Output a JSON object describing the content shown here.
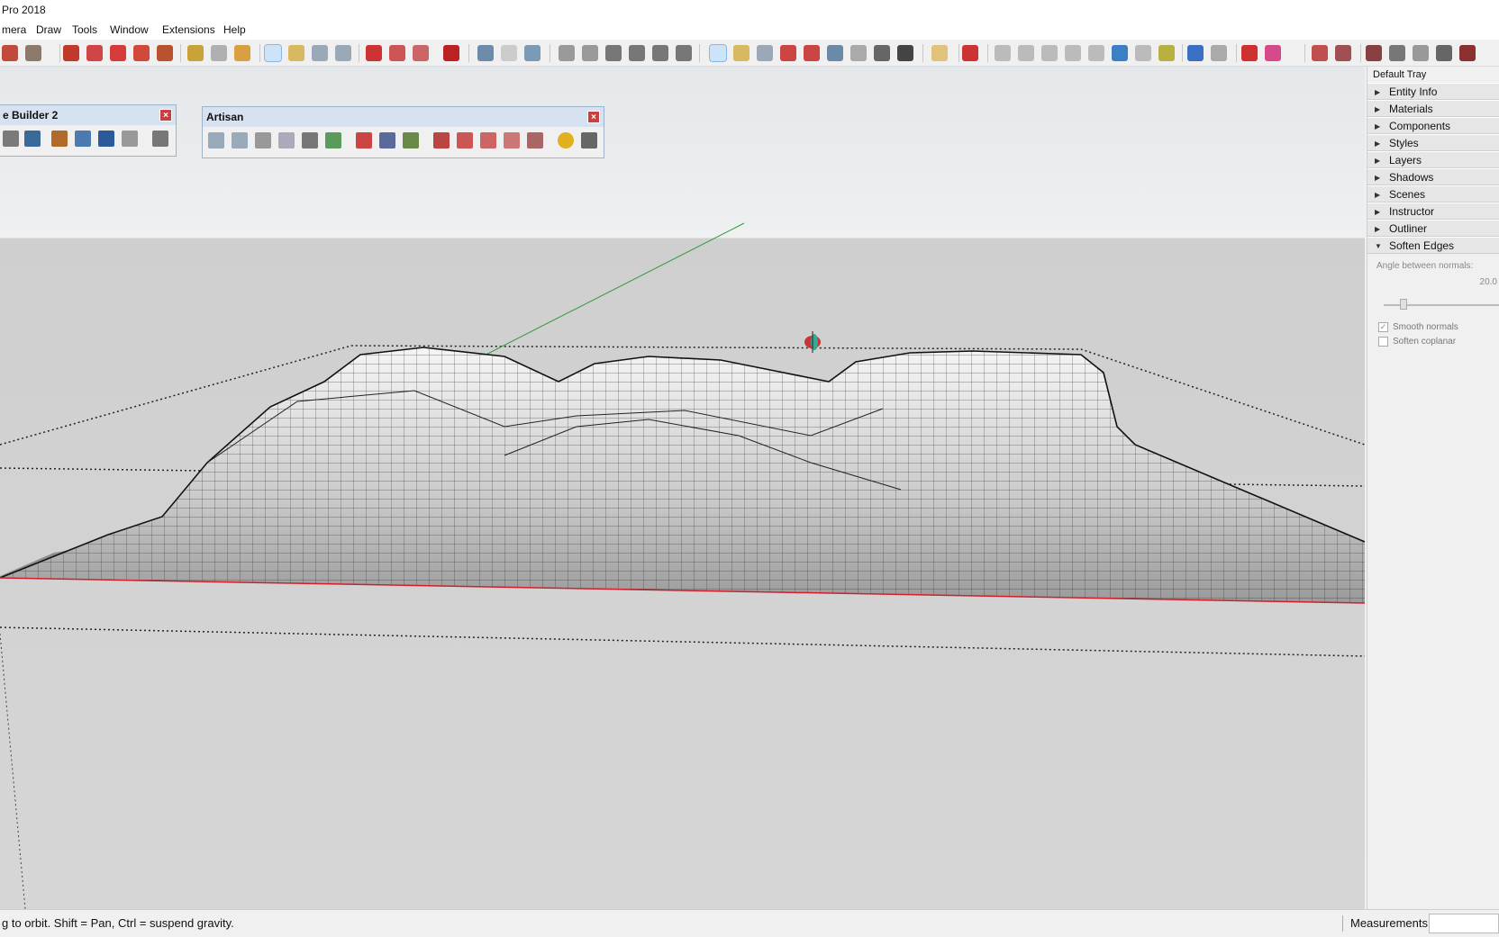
{
  "window": {
    "title": "Pro 2018"
  },
  "menu": [
    "mera",
    "Draw",
    "Tools",
    "Window",
    "Extensions",
    "Help"
  ],
  "toolbars": {
    "builder": {
      "title": "e Builder 2",
      "close": "×"
    },
    "artisan": {
      "title": "Artisan",
      "close": "×"
    }
  },
  "tray": {
    "title": "Default Tray",
    "items": [
      "Entity Info",
      "Materials",
      "Components",
      "Styles",
      "Layers",
      "Shadows",
      "Scenes",
      "Instructor",
      "Outliner",
      "Soften Edges"
    ],
    "soften_edges": {
      "angle_label": "Angle between normals:",
      "angle_value": "20.0",
      "smooth_normals": "Smooth normals",
      "smooth_checked": true,
      "soften_coplanar": "Soften coplanar",
      "coplanar_checked": false
    }
  },
  "status": {
    "hint": "g to orbit. Shift = Pan, Ctrl = suspend gravity.",
    "measurements_label": "Measurements",
    "measurements_value": ""
  },
  "colors": {
    "accent_active": "#cde3f7",
    "axis_red": "#d0202a",
    "axis_green": "#2e9a3a"
  }
}
